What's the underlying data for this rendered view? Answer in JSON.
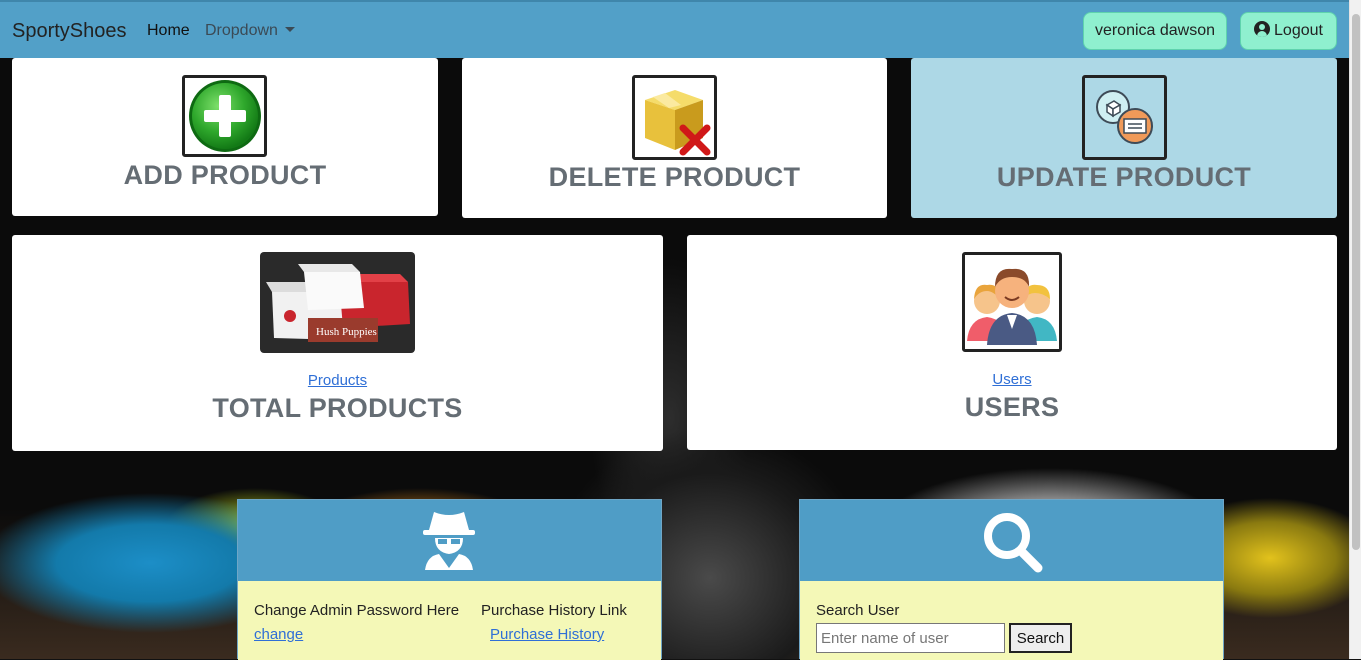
{
  "navbar": {
    "brand": "SportyShoes",
    "home": "Home",
    "dropdown": "Dropdown",
    "user": "veronica dawson",
    "logout": "Logout"
  },
  "cards": {
    "add": {
      "title": "ADD PRODUCT",
      "icon": "plus-icon"
    },
    "delete": {
      "title": "DELETE PRODUCT",
      "icon": "box-delete-icon"
    },
    "update": {
      "title": "UPDATE PRODUCT",
      "icon": "update-icon"
    },
    "total": {
      "link": "Products",
      "title": "TOTAL PRODUCTS",
      "image": "shoe-boxes-image"
    },
    "users": {
      "link": "Users",
      "title": "USERS",
      "image": "users-group-image"
    }
  },
  "panels": {
    "admin": {
      "icon": "spy-icon",
      "change_label": "Change Admin Password Here",
      "change_link": "change",
      "history_label": "Purchase History Link",
      "history_link": "Purchase History"
    },
    "search": {
      "icon": "search-icon",
      "label": "Search User",
      "placeholder": "Enter name of user",
      "button": "Search"
    }
  },
  "colors": {
    "navbar": "#52a0c8",
    "accent_button": "#8ff0cf",
    "panel_head": "#4f9dc6",
    "panel_body": "#f4f8b7",
    "highlight_card": "#add8e6"
  }
}
